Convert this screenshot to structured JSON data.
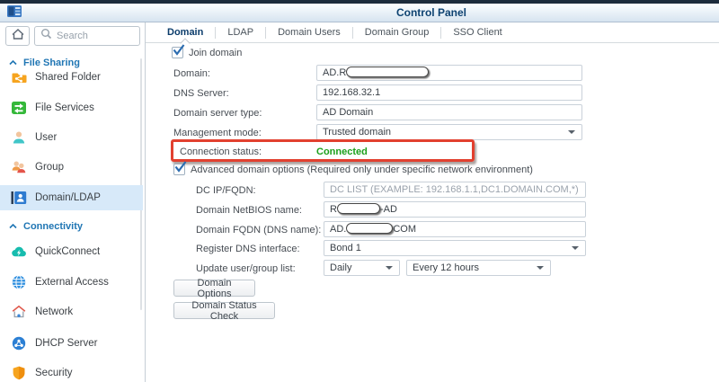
{
  "window": {
    "title": "Control Panel"
  },
  "colors": {
    "accent_blue": "#2b6cb0",
    "selected_item_bg": "#d7e9f9",
    "section_header_blue": "#2076b4",
    "active_tab_blue": "#0b3c6b",
    "status_green": "#1ba01b",
    "annotation_red": "#e2402f"
  },
  "sidebar": {
    "search_placeholder": "Search",
    "selected_item": "Domain/LDAP",
    "sections": [
      {
        "label": "File Sharing",
        "items": [
          {
            "label": "Shared Folder",
            "icon": "shared-folder-icon"
          },
          {
            "label": "File Services",
            "icon": "file-services-icon"
          },
          {
            "label": "User",
            "icon": "user-icon"
          },
          {
            "label": "Group",
            "icon": "group-icon"
          },
          {
            "label": "Domain/LDAP",
            "icon": "domain-ldap-icon"
          }
        ]
      },
      {
        "label": "Connectivity",
        "items": [
          {
            "label": "QuickConnect",
            "icon": "quickconnect-icon"
          },
          {
            "label": "External Access",
            "icon": "external-access-icon"
          },
          {
            "label": "Network",
            "icon": "network-icon"
          },
          {
            "label": "DHCP Server",
            "icon": "dhcp-server-icon"
          },
          {
            "label": "Security",
            "icon": "security-icon"
          }
        ]
      }
    ]
  },
  "tabs": {
    "items": [
      {
        "label": "Domain",
        "active": true
      },
      {
        "label": "LDAP",
        "active": false
      },
      {
        "label": "Domain Users",
        "active": false
      },
      {
        "label": "Domain Group",
        "active": false
      },
      {
        "label": "SSO Client",
        "active": false
      }
    ]
  },
  "form": {
    "join_domain": {
      "label": "Join domain",
      "checked": true
    },
    "domain": {
      "label": "Domain:",
      "value_visible": "AD.R",
      "redacted": true
    },
    "dns_server": {
      "label": "DNS Server:",
      "value": "192.168.32.1"
    },
    "domain_server_type": {
      "label": "Domain server type:",
      "value": "AD Domain"
    },
    "management_mode": {
      "label": "Management mode:",
      "value": "Trusted domain"
    },
    "connection_status": {
      "label": "Connection status:",
      "value": "Connected",
      "highlighted": true
    },
    "advanced": {
      "label": "Advanced domain options (Required only under specific network environment)",
      "checked": true,
      "dc_ip": {
        "label": "DC IP/FQDN:",
        "placeholder": "DC LIST (EXAMPLE: 192.168.1.1,DC1.DOMAIN.COM,*)"
      },
      "netbios": {
        "label": "Domain NetBIOS name:",
        "value_prefix": "R",
        "value_suffix": "-AD",
        "redacted": true
      },
      "fqdn": {
        "label": "Domain FQDN (DNS name):",
        "value_prefix": "AD.",
        "value_suffix": "COM",
        "redacted": true
      },
      "register_dns": {
        "label": "Register DNS interface:",
        "value": "Bond 1"
      },
      "update_list": {
        "label": "Update user/group list:",
        "value1": "Daily",
        "value2": "Every 12 hours"
      }
    },
    "buttons": {
      "domain_options": "Domain Options",
      "domain_status_check": "Domain Status Check"
    }
  }
}
